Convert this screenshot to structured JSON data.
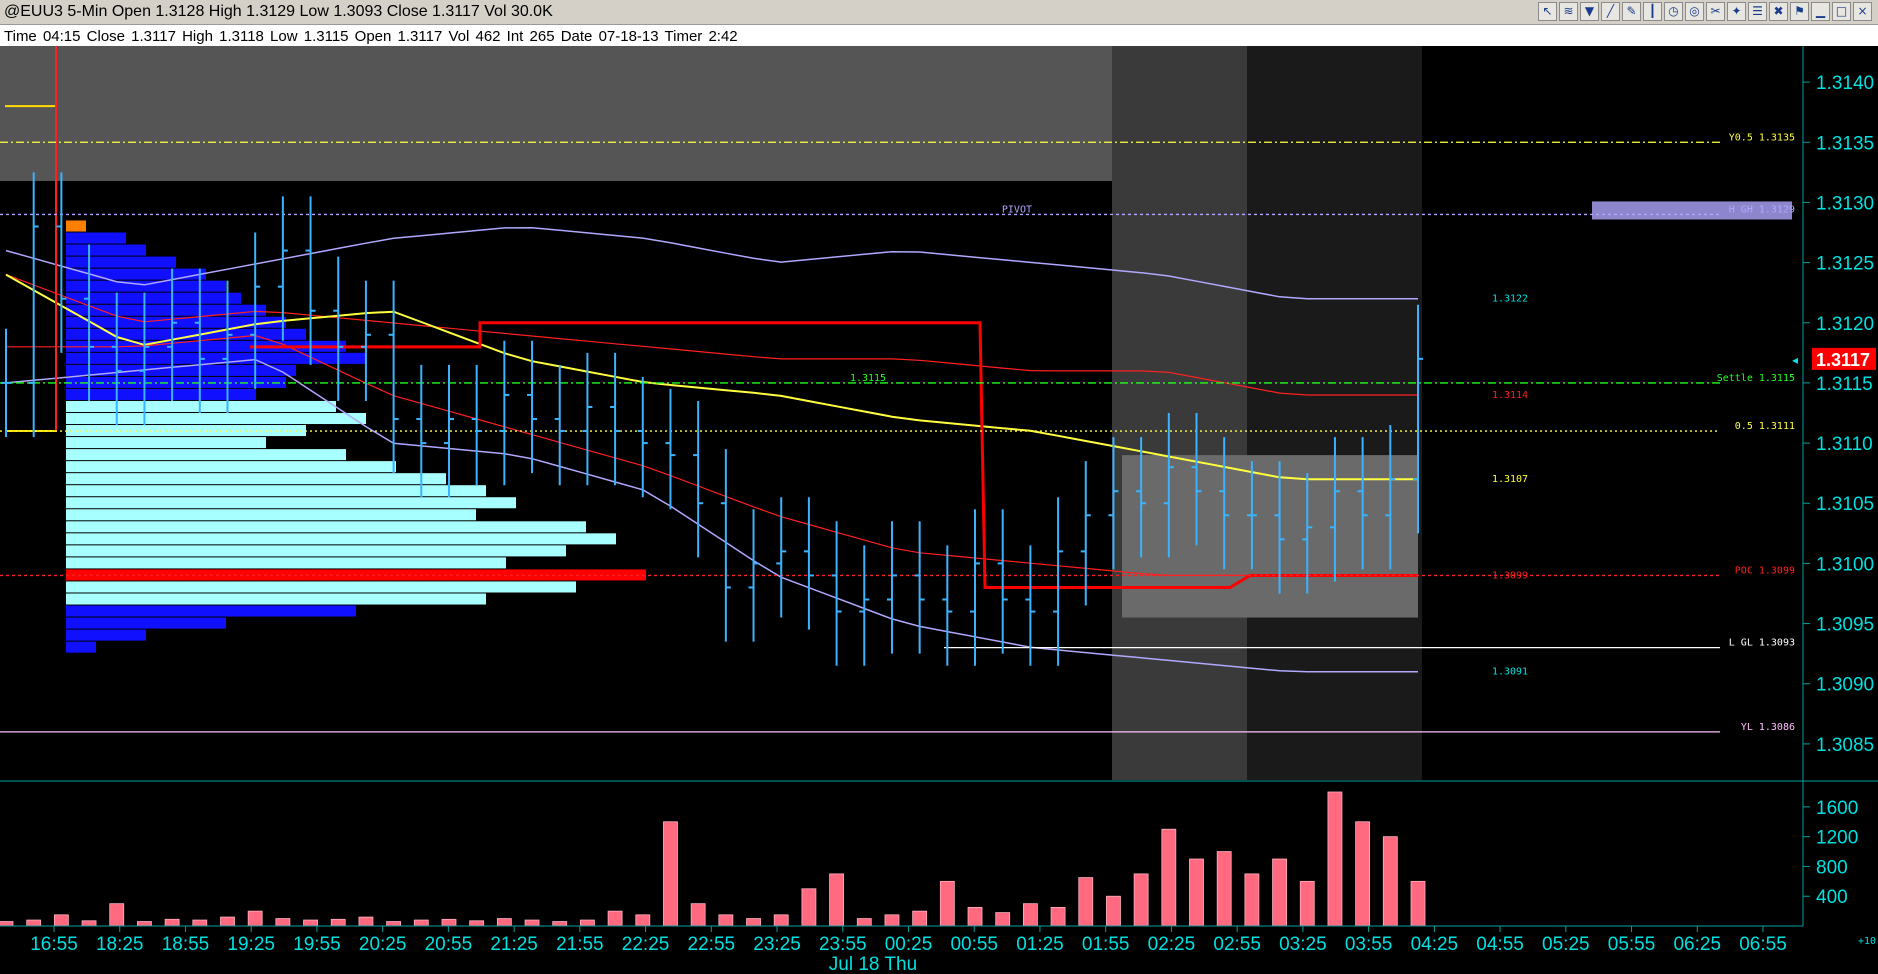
{
  "window": {
    "title": "@EUU3 5-Min Open 1.3128 High 1.3129 Low 1.3093 Close 1.3117 Vol 30.0K"
  },
  "toolbar": {
    "icons": [
      "cursor-icon",
      "chart-style-icon",
      "indicator-icon",
      "draw-icon",
      "pencil-icon",
      "bar-style-icon",
      "clock-icon",
      "target-icon",
      "tool-icon",
      "marker-icon",
      "menu-icon",
      "delete-icon",
      "flag-icon",
      "minimize-icon",
      "maximize-icon",
      "close-icon"
    ]
  },
  "info": {
    "text": "Time 04:15   Close 1.3117   High 1.3118   Low 1.3115   Open 1.3117   Vol 462   Int 265   Date 07-18-13   Timer 2:42"
  },
  "colors": {
    "background": "#000000",
    "grid_line": "#00a0a0",
    "axis_text": "#00e0e0",
    "price_bar": "#3ab4ff",
    "vwap": "#ffff40",
    "bands_red": "#ff2020",
    "bands_purple": "#b0a8ff",
    "volume": "#ff6a80",
    "profile_value_area": "#a8ffff",
    "profile_outer": "#1010ff",
    "poc": "#ff0000",
    "session_shade": "#3a3a3a",
    "current_price_box": "#ff0000"
  },
  "chart_data": {
    "type": "bar",
    "title": "@EUU3 5-Min",
    "y_axis": {
      "min": 1.3082,
      "max": 1.3143,
      "ticks": [
        "1.3140",
        "1.3135",
        "1.3130",
        "1.3125",
        "1.3120",
        "1.3115",
        "1.3110",
        "1.3105",
        "1.3100",
        "1.3095",
        "1.3090",
        "1.3085"
      ]
    },
    "x_axis": {
      "ticks": [
        "16:55",
        "18:25",
        "18:55",
        "19:25",
        "19:55",
        "20:25",
        "20:55",
        "21:25",
        "21:55",
        "22:25",
        "22:55",
        "23:25",
        "23:55",
        "00:25",
        "00:55",
        "01:25",
        "01:55",
        "02:25",
        "02:55",
        "03:25",
        "03:55",
        "04:25",
        "04:55",
        "05:25",
        "05:55",
        "06:25",
        "06:55"
      ],
      "date_label": "Jul 18 Thu"
    },
    "current_price": "1.3117",
    "levels": [
      {
        "label": "Y0.5 1.3135",
        "price": 1.3135,
        "color": "#ffff40",
        "style": "dashdot"
      },
      {
        "label": "H GH 1.3129",
        "price": 1.3129,
        "color": "#b0a8ff",
        "style": "dashed"
      },
      {
        "label": "PIVOT",
        "price": 1.3129,
        "color": "#b0a8ff",
        "style": "dashed"
      },
      {
        "label": "Settle 1.3115",
        "price": 1.3115,
        "color": "#20ff20",
        "style": "dashdot"
      },
      {
        "label": "1.3115",
        "price": 1.3115,
        "color": "#20ff20",
        "style": "none"
      },
      {
        "label": "0.5 1.3111",
        "price": 1.3111,
        "color": "#ffff40",
        "style": "dotted"
      },
      {
        "label": "POC 1.3099",
        "price": 1.3099,
        "color": "#ff2020",
        "style": "dashed"
      },
      {
        "label": "L GL 1.3093",
        "price": 1.3093,
        "color": "#ffffff",
        "style": "solid"
      },
      {
        "label": "YL 1.3086",
        "price": 1.3086,
        "color": "#ffc0ff",
        "style": "solid"
      }
    ],
    "band_labels": [
      {
        "label": "1.3122",
        "price": 1.3122,
        "color": "#00e0e0"
      },
      {
        "label": "1.3114",
        "price": 1.3114,
        "color": "#ff2020"
      },
      {
        "label": "1.3107",
        "price": 1.3107,
        "color": "#ffff40"
      },
      {
        "label": "1.3099",
        "price": 1.3099,
        "color": "#ff2020"
      },
      {
        "label": "1.3091",
        "price": 1.3091,
        "color": "#00e0e0"
      }
    ],
    "series": [
      {
        "name": "price",
        "values": [
          1.3115,
          1.3128,
          1.3122,
          1.3118,
          1.3116,
          1.3118,
          1.312,
          1.3117,
          1.3119,
          1.3123,
          1.3126,
          1.3121,
          1.3118,
          1.3119,
          1.3112,
          1.311,
          1.3112,
          1.3111,
          1.3114,
          1.3112,
          1.3111,
          1.3113,
          1.3111,
          1.311,
          1.3109,
          1.3105,
          1.3098,
          1.31,
          1.3101,
          1.3099,
          1.3096,
          1.3097,
          1.3099,
          1.3097,
          1.3096,
          1.31,
          1.3097,
          1.3096,
          1.3101,
          1.3104,
          1.3106,
          1.3105,
          1.3108,
          1.3106,
          1.3104,
          1.3104,
          1.3102,
          1.3103,
          1.3106,
          1.3104,
          1.3107,
          1.3117
        ]
      },
      {
        "name": "volume",
        "values": [
          60,
          80,
          150,
          70,
          300,
          60,
          90,
          80,
          120,
          200,
          100,
          80,
          90,
          120,
          60,
          80,
          90,
          70,
          100,
          80,
          60,
          80,
          200,
          150,
          1400,
          300,
          150,
          100,
          150,
          500,
          700,
          100,
          150,
          200,
          600,
          250,
          180,
          300,
          250,
          650,
          400,
          700,
          1300,
          900,
          1000,
          700,
          900,
          600,
          1800,
          1400,
          1200,
          600
        ]
      }
    ],
    "volume_axis": {
      "ticks": [
        "1600",
        "1200",
        "800",
        "400"
      ],
      "max": 1800,
      "corner_label": "+10"
    }
  }
}
